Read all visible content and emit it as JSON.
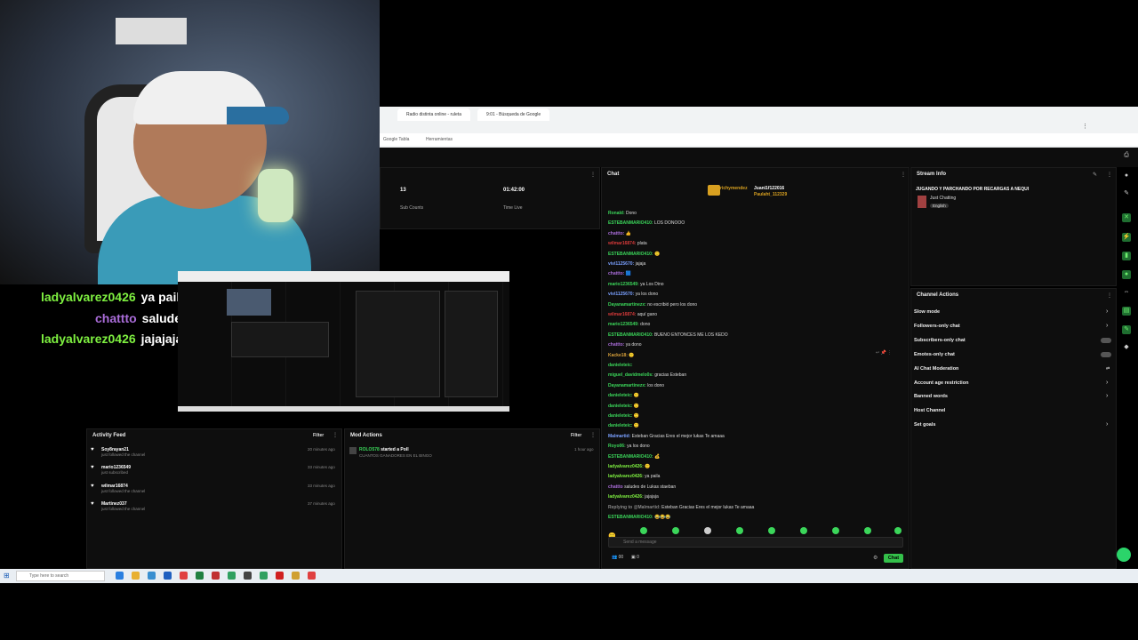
{
  "overlay_chat": [
    {
      "user": "ladyalvarez0426",
      "msg": "ya paila",
      "color": "#7ef040"
    },
    {
      "user": "chattto",
      "msg": "saludes de Lukas staeban",
      "color": "#a96cd8"
    },
    {
      "user": "ladyalvarez0426",
      "msg": "jajajaja",
      "color": "#7ef040"
    }
  ],
  "browser": {
    "tabs": [
      "Radio distinta online - ruleta",
      "9:01 - Búsqueda de Google"
    ],
    "bookmarks": [
      "Google Tabla",
      "Herramientas"
    ]
  },
  "stats": {
    "sub_count": "13",
    "sub_label": "Sub Counts",
    "time": "01:42:00",
    "time_label": "Time Live"
  },
  "chat": {
    "title": "Chat",
    "pinned": [
      {
        "user": "richymendez",
        "count": "1"
      },
      {
        "user": "Juani1f122016",
        "count": "1"
      },
      {
        "user": "Paulaht_112329",
        "count": "1"
      }
    ],
    "messages": [
      {
        "user": "Ronald:",
        "msg": "Dono",
        "color": "#3bd65a"
      },
      {
        "user": "ESTEBANMARIO410:",
        "msg": "LOS DONOOO",
        "color": "#3bd65a"
      },
      {
        "user": "chattto:",
        "msg": "👍",
        "color": "#a96cd8"
      },
      {
        "user": "wilmar16874:",
        "msg": "plata",
        "color": "#d83a3a"
      },
      {
        "user": "ESTEBANMARIO410:",
        "msg": "🙂",
        "color": "#3bd65a"
      },
      {
        "user": "vivi1125670:",
        "msg": "jajaja",
        "color": "#7aa0ff"
      },
      {
        "user": "chattto:",
        "msg": "🟦",
        "color": "#a96cd8"
      },
      {
        "user": "mario1236549:",
        "msg": "ya Los Dino",
        "color": "#3bd65a"
      },
      {
        "user": "vivi1125670:",
        "msg": "ya los dono",
        "color": "#7aa0ff"
      },
      {
        "user": "Dayanamartinezx:",
        "msg": "no escribió pero los dono",
        "color": "#3bd65a"
      },
      {
        "user": "wilmar16874:",
        "msg": "aquí gano",
        "color": "#d83a3a"
      },
      {
        "user": "mario1236549:",
        "msg": "dono",
        "color": "#3bd65a"
      },
      {
        "user": "ESTEBANMARIO410:",
        "msg": "BUENO ENTONCES ME LOS KEDO",
        "color": "#3bd65a"
      },
      {
        "user": "chattto:",
        "msg": "ya dono",
        "color": "#a96cd8"
      },
      {
        "user": "Kacke18:",
        "msg": "🙂",
        "color": "#d8a03a"
      },
      {
        "user": "danieleteic:",
        "msg": "",
        "color": "#3bd65a"
      },
      {
        "user": "miguel_davidmelo0s:",
        "msg": "gracias Esteban",
        "color": "#3bd65a"
      },
      {
        "user": "Dayanamartinezx:",
        "msg": "los dono",
        "color": "#3bd65a"
      },
      {
        "user": "danieleteic:",
        "msg": "🙂",
        "color": "#3bd65a"
      },
      {
        "user": "danieleteic:",
        "msg": "🙂",
        "color": "#3bd65a"
      },
      {
        "user": "danieleteic:",
        "msg": "🙂",
        "color": "#3bd65a"
      },
      {
        "user": "danieleteic:",
        "msg": "🙂",
        "color": "#3bd65a"
      },
      {
        "user": "Malmartid:",
        "msg": "Esteban Gracias Eres el mejor lukas Te amaaa",
        "color": "#7aa0ff"
      },
      {
        "user": "Royo06:",
        "msg": "ya los dono",
        "color": "#3bd65a"
      },
      {
        "user": "ESTEBANMARIO410:",
        "msg": "💰",
        "color": "#3bd65a"
      },
      {
        "user": "ladyalvarez0426:",
        "msg": "🙂",
        "color": "#7ef040"
      },
      {
        "user": "ladyalvarez0426:",
        "msg": "ya paila",
        "color": "#7ef040"
      },
      {
        "user": "chattto",
        "msg": "saludes de Lukas staeban",
        "color": "#a96cd8"
      },
      {
        "user": "ladyalvarez0426:",
        "msg": "jajajaja",
        "color": "#7ef040"
      },
      {
        "user": "Replying to @Malmartid:",
        "msg": "Esteban Gracias Eres el mejor lukas Te amaaa",
        "color": "#888888"
      },
      {
        "user": "ESTEBANMARIO410:",
        "msg": "😂😂😂",
        "color": "#3bd65a"
      }
    ],
    "input_placeholder": "Send a message",
    "viewers": "00",
    "points": "0",
    "send_label": "Chat"
  },
  "stream_info": {
    "title": "Stream Info",
    "stream_title": "JUGANDO Y PARCHANDO POR RECARGAS A NEQUI",
    "category": "Just Chatting",
    "language": "English"
  },
  "channel_actions": {
    "title": "Channel Actions",
    "items": [
      {
        "label": "Slow mode",
        "control": "chevron"
      },
      {
        "label": "Followers-only chat",
        "control": "chevron"
      },
      {
        "label": "Subscribers-only chat",
        "control": "toggle"
      },
      {
        "label": "Emotes-only chat",
        "control": "toggle"
      },
      {
        "label": "AI Chat Moderation",
        "control": "icon"
      },
      {
        "label": "Account age restriction",
        "control": "chevron"
      },
      {
        "label": "Banned words",
        "control": "chevron"
      },
      {
        "label": "Host Channel",
        "control": "none"
      },
      {
        "label": "Set goals",
        "control": "chevron"
      }
    ]
  },
  "activity_feed": {
    "title": "Activity Feed",
    "filter": "Filter",
    "items": [
      {
        "name": "Soy8rayan21",
        "sub": "just followed the channel",
        "time": "20 minutes ago"
      },
      {
        "name": "mario1236549",
        "sub": "just subscribed",
        "time": "33 minutes ago"
      },
      {
        "name": "wilmar16874",
        "sub": "just followed the channel",
        "time": "33 minutes ago"
      },
      {
        "name": "Martinez037",
        "sub": "just followed the channel",
        "time": "37 minutes ago"
      }
    ]
  },
  "mod_actions": {
    "title": "Mod Actions",
    "filter": "Filter",
    "entry_user": "ROLO578",
    "entry_action": "started a Poll",
    "entry_detail": "CUANTOS GANADORES EN EL BINGO",
    "entry_time": "1 hour ago"
  },
  "taskbar": {
    "search_placeholder": "Type here to search"
  }
}
